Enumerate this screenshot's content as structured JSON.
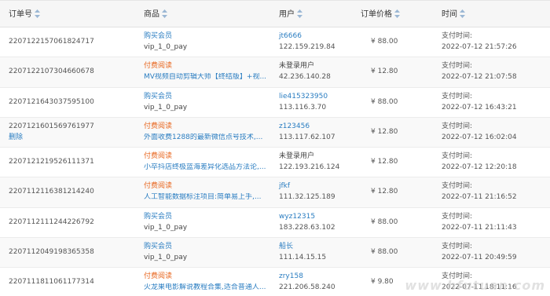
{
  "columns": {
    "order_no": "订单号",
    "product": "商品",
    "user": "用户",
    "price": "订单价格",
    "time": "时间"
  },
  "colors": {
    "link": "#2a7dc1",
    "paid_read": "#e8661e",
    "header_bg": "#f6f6f6"
  },
  "rows": [
    {
      "order_no": "2207122157061824717",
      "extra": "",
      "type": "购买会员",
      "type_style": "blue",
      "title": "vip_1_0_pay",
      "title_style": "dark",
      "user": "jt6666",
      "user_style": "blue",
      "ip": "122.159.219.84",
      "price": "¥ 88.00",
      "time_label": "支付时间:",
      "time": "2022-07-12 21:57:26"
    },
    {
      "order_no": "2207122107304660678",
      "extra": "",
      "type": "付费阅读",
      "type_style": "orange",
      "title": "MV视频自动剪辑大师【终结版】+视...",
      "title_style": "blue",
      "user": "未登录用户",
      "user_style": "dark",
      "ip": "42.236.140.28",
      "price": "¥ 12.80",
      "time_label": "支付时间:",
      "time": "2022-07-12 21:07:58"
    },
    {
      "order_no": "2207121643037595100",
      "extra": "",
      "type": "购买会员",
      "type_style": "blue",
      "title": "vip_1_0_pay",
      "title_style": "dark",
      "user": "lie415323950",
      "user_style": "blue",
      "ip": "113.116.3.70",
      "price": "¥ 88.00",
      "time_label": "支付时间:",
      "time": "2022-07-12 16:43:21"
    },
    {
      "order_no": "2207121601569761977",
      "extra": "删除",
      "type": "付费阅读",
      "type_style": "orange",
      "title": "外面收费1288的最新微信点号技术,...",
      "title_style": "blue",
      "user": "z123456",
      "user_style": "blue",
      "ip": "113.117.62.107",
      "price": "¥ 12.80",
      "time_label": "支付时间:",
      "time": "2022-07-12 16:02:04"
    },
    {
      "order_no": "2207121219526111371",
      "extra": "",
      "type": "付费阅读",
      "type_style": "orange",
      "title": "小卒抖店终极蓝海差异化选品方法论,...",
      "title_style": "blue",
      "user": "未登录用户",
      "user_style": "dark",
      "ip": "122.193.216.124",
      "price": "¥ 12.80",
      "time_label": "支付时间:",
      "time": "2022-07-12 12:20:18"
    },
    {
      "order_no": "2207112116381214240",
      "extra": "",
      "type": "付费阅读",
      "type_style": "orange",
      "title": "人工智能数据标注项目:简单易上手,...",
      "title_style": "blue",
      "user": "jfkf",
      "user_style": "blue",
      "ip": "111.32.125.189",
      "price": "¥ 12.80",
      "time_label": "支付时间:",
      "time": "2022-07-11 21:16:52"
    },
    {
      "order_no": "2207112111244226792",
      "extra": "",
      "type": "购买会员",
      "type_style": "blue",
      "title": "vip_1_0_pay",
      "title_style": "dark",
      "user": "wyz12315",
      "user_style": "blue",
      "ip": "183.228.63.102",
      "price": "¥ 88.00",
      "time_label": "支付时间:",
      "time": "2022-07-11 21:11:43"
    },
    {
      "order_no": "2207112049198365358",
      "extra": "",
      "type": "购买会员",
      "type_style": "blue",
      "title": "vip_1_0_pay",
      "title_style": "dark",
      "user": "船长",
      "user_style": "blue",
      "ip": "111.14.15.15",
      "price": "¥ 88.00",
      "time_label": "支付时间:",
      "time": "2022-07-11 20:49:59"
    },
    {
      "order_no": "2207111811061177314",
      "extra": "",
      "type": "付费阅读",
      "type_style": "orange",
      "title": "火龙果电影解说教程合集,适合普通人...",
      "title_style": "blue",
      "user": "zry158",
      "user_style": "blue",
      "ip": "221.206.58.240",
      "price": "¥ 9.80",
      "time_label": "支付时间:",
      "time": "2022-07-11 18:11:16"
    }
  ],
  "watermark": "www.hfutuan.com"
}
